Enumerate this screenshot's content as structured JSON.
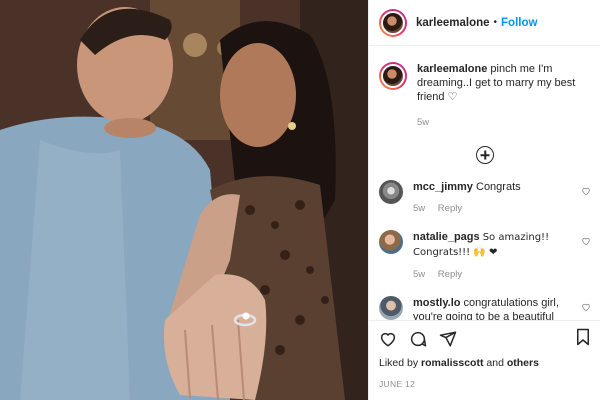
{
  "post": {
    "username": "karleemalone",
    "follow_label": "Follow",
    "separator": "•"
  },
  "caption": {
    "username": "karleemalone",
    "text": "pinch me I'm dreaming..I get to marry my best friend ♡",
    "time": "5w"
  },
  "comments": [
    {
      "username": "mcc_jimmy",
      "text": "Congrats",
      "time": "5w",
      "reply": "Reply"
    },
    {
      "username": "natalie_pags",
      "text": "So amazing!! Congrats!!! 🙌 ❤",
      "time": "5w",
      "reply": "Reply"
    },
    {
      "username": "mostly.lo",
      "text": "congratulations girl, you're going to be a beautiful",
      "time": "",
      "reply": ""
    }
  ],
  "likes": {
    "prefix": "Liked by",
    "user": "romalisscott",
    "conjunction": "and",
    "others": "others"
  },
  "date": "JUNE 12",
  "icons": {
    "like": "heart-icon",
    "comment": "comment-icon",
    "share": "paper-plane-icon",
    "save": "bookmark-icon",
    "load_more": "plus-circle-icon"
  },
  "colors": {
    "link": "#0095f6",
    "muted": "#8e8e8e",
    "text": "#262626"
  }
}
